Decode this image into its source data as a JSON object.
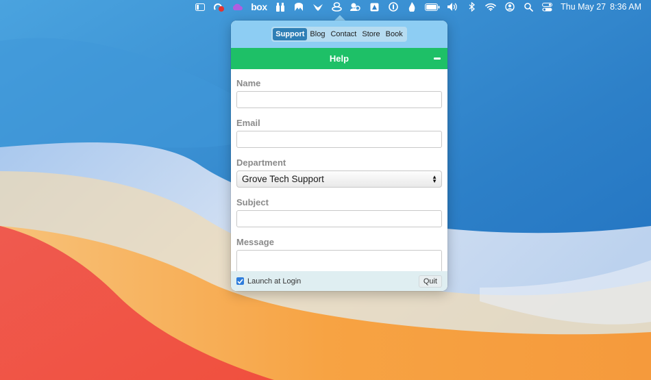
{
  "menubar": {
    "icons": [
      "window-icon",
      "creative-cloud-icon",
      "cloud-sync-icon",
      "box-logo",
      "binoculars-icon",
      "malwarebytes-icon",
      "bird-icon",
      "help-stack-icon",
      "gear-user-icon",
      "drive-icon",
      "one-password-icon",
      "flame-icon",
      "battery-icon",
      "volume-icon",
      "bluetooth-icon",
      "wifi-icon",
      "user-icon",
      "spotlight-icon",
      "control-center-icon"
    ],
    "box_label": "box",
    "date": "Thu May 27",
    "time": "8:36 AM"
  },
  "popover": {
    "tabs": [
      {
        "label": "Support",
        "active": true
      },
      {
        "label": "Blog",
        "active": false
      },
      {
        "label": "Contact",
        "active": false
      },
      {
        "label": "Store",
        "active": false
      },
      {
        "label": "Book",
        "active": false
      }
    ],
    "header_title": "Help",
    "form": {
      "name_label": "Name",
      "name_value": "",
      "email_label": "Email",
      "email_value": "",
      "department_label": "Department",
      "department_value": "Grove Tech Support",
      "subject_label": "Subject",
      "subject_value": "",
      "message_label": "Message",
      "message_value": ""
    },
    "footer": {
      "launch_label": "Launch at Login",
      "launch_checked": true,
      "quit_label": "Quit"
    }
  },
  "colors": {
    "nav_bg": "#8dcdf3",
    "active_tab": "#2f7fb6",
    "help_bar": "#1ec067",
    "checkbox": "#2f7ddb"
  }
}
